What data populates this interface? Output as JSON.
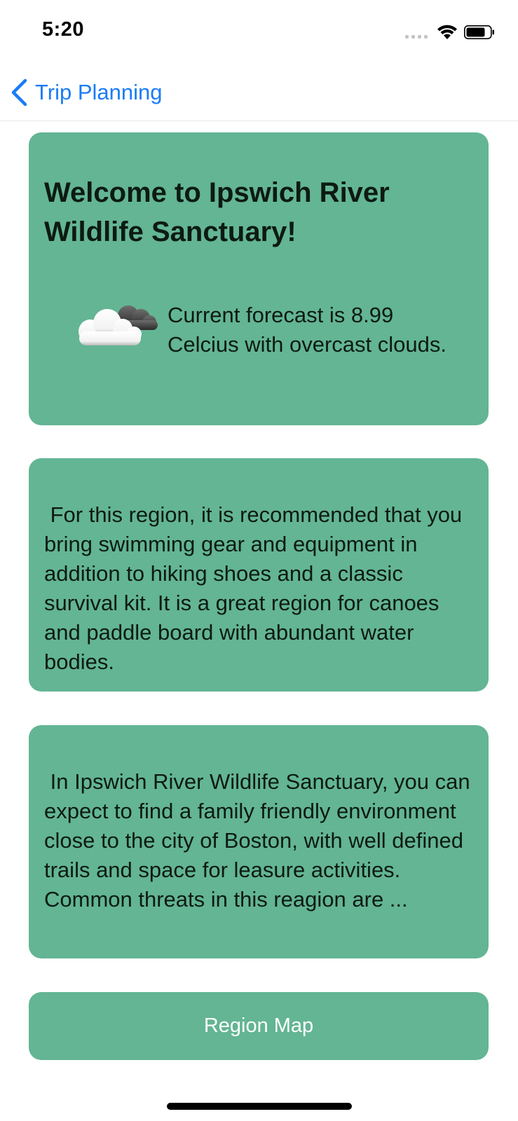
{
  "status_bar": {
    "time": "5:20"
  },
  "nav": {
    "back_label": "Trip Planning",
    "accent_color": "#1a7cf5"
  },
  "welcome_card": {
    "title": "Welcome to Ipswich River Wildlife Sanctuary!",
    "weather_icon": "overcast-clouds-icon",
    "forecast": "Current forecast is 8.99 Celcius with overcast clouds."
  },
  "gear_card": {
    "text": " For this region, it is recommended that you bring swimming gear and equipment in addition to hiking shoes and a classic survival kit. It is a great region for canoes and paddle board with abundant water bodies."
  },
  "expect_card": {
    "text": " In Ipswich River Wildlife Sanctuary, you can expect to find a family friendly environment close to the city of Boston, with well defined trails and space for leasure activities. Common threats in this reagion are ..."
  },
  "map_button": {
    "label": "Region Map"
  },
  "colors": {
    "card_background": "#63b594",
    "card_text": "#0d1a14",
    "button_text": "#ffffff"
  }
}
